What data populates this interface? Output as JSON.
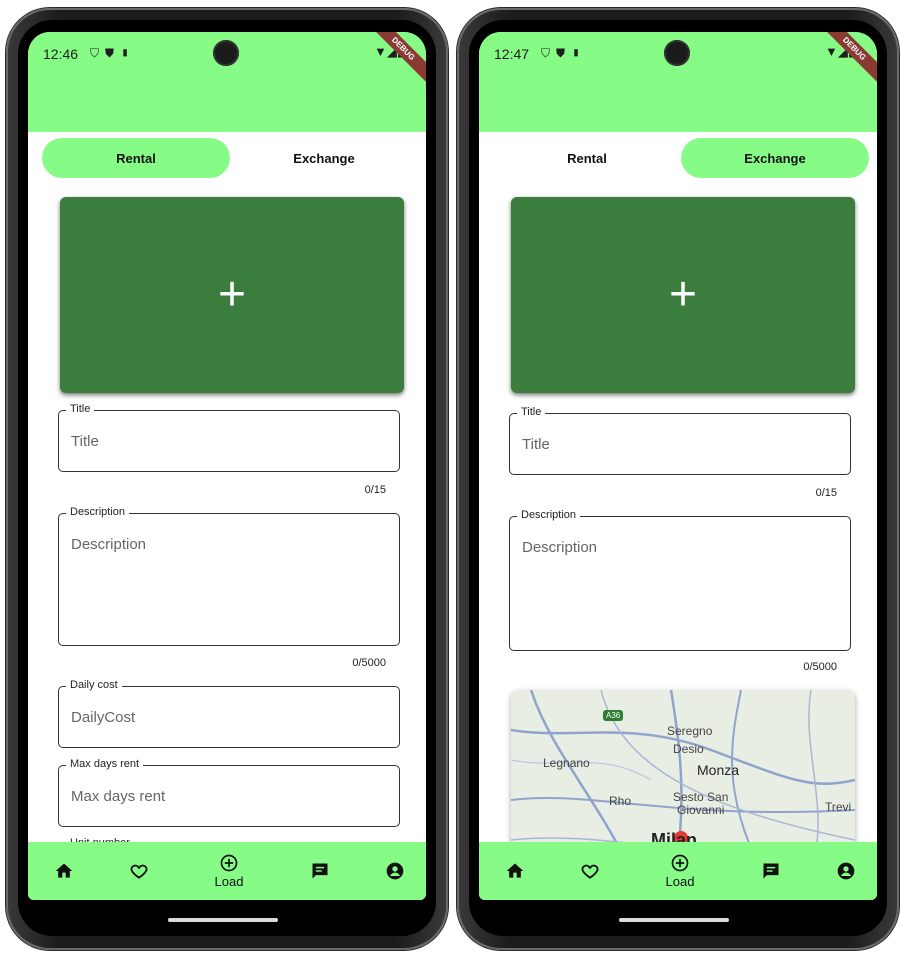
{
  "colors": {
    "accent": "#86fb86",
    "image_tile": "#3a7d3c"
  },
  "left": {
    "status": {
      "time": "12:46",
      "debug": "DEBUG"
    },
    "tabs": {
      "rental": "Rental",
      "exchange": "Exchange",
      "active": "rental"
    },
    "fields": {
      "title": {
        "label": "Title",
        "placeholder": "Title",
        "counter": "0/15"
      },
      "description": {
        "label": "Description",
        "placeholder": "Description",
        "counter": "0/5000"
      },
      "daily_cost": {
        "label": "Daily cost",
        "placeholder": "DailyCost"
      },
      "max_days": {
        "label": "Max days rent",
        "placeholder": "Max days rent"
      },
      "unit_number": {
        "label": "Unit number"
      }
    },
    "nav": {
      "load_label": "Load"
    }
  },
  "right": {
    "status": {
      "time": "12:47",
      "debug": "DEBUG"
    },
    "tabs": {
      "rental": "Rental",
      "exchange": "Exchange",
      "active": "exchange"
    },
    "fields": {
      "title": {
        "label": "Title",
        "placeholder": "Title",
        "counter": "0/15"
      },
      "description": {
        "label": "Description",
        "placeholder": "Description",
        "counter": "0/5000"
      }
    },
    "map": {
      "labels": [
        "Seregno",
        "Desio",
        "Legnano",
        "Monza",
        "Rho",
        "Sesto San",
        "Giovanni",
        "Trevi",
        "Milan"
      ],
      "road": "A36"
    },
    "nav": {
      "load_label": "Load"
    }
  }
}
